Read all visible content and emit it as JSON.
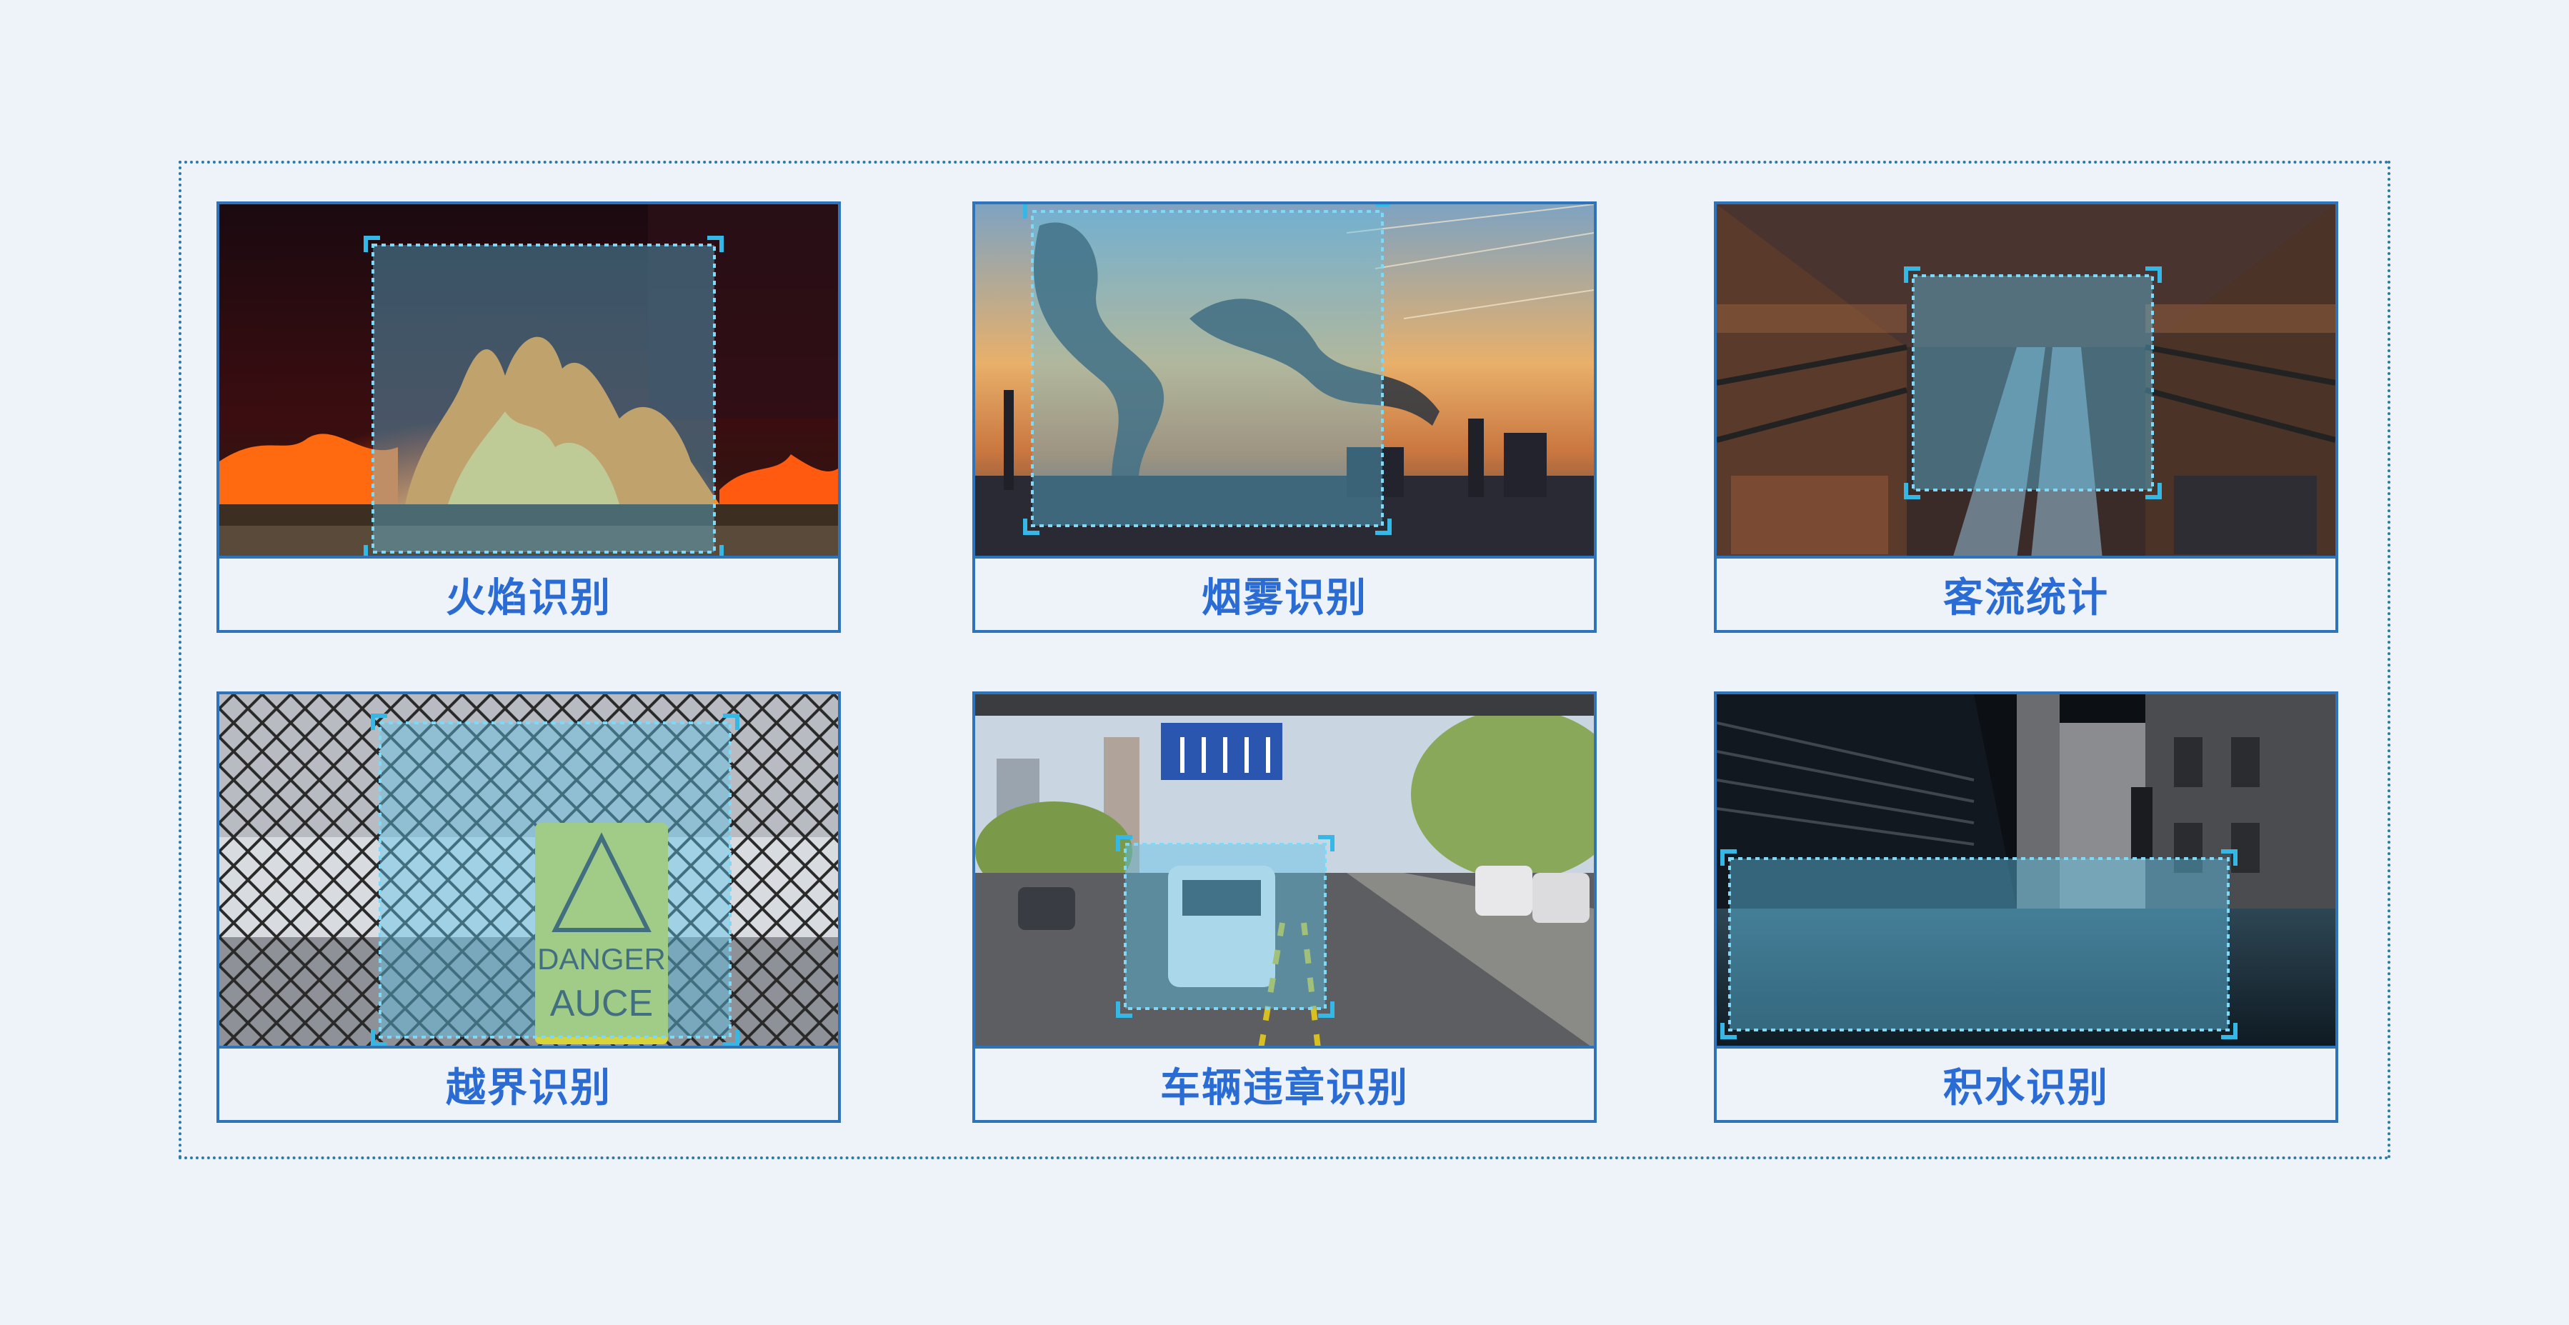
{
  "cards": [
    {
      "label": "火焰识别",
      "scene": "fire"
    },
    {
      "label": "烟雾识别",
      "scene": "smoke"
    },
    {
      "label": "客流统计",
      "scene": "mall"
    },
    {
      "label": "越界识别",
      "scene": "fence",
      "sign_text": [
        "DANGER",
        "AUCE"
      ]
    },
    {
      "label": "车辆违章识别",
      "scene": "street"
    },
    {
      "label": "积水识别",
      "scene": "alley"
    }
  ],
  "colors": {
    "background": "#eef2f9",
    "border": "#2f73ba",
    "label": "#2a6cd3",
    "detection_fill": "#5fc4e8",
    "detection_stroke": "#36b8e6"
  }
}
